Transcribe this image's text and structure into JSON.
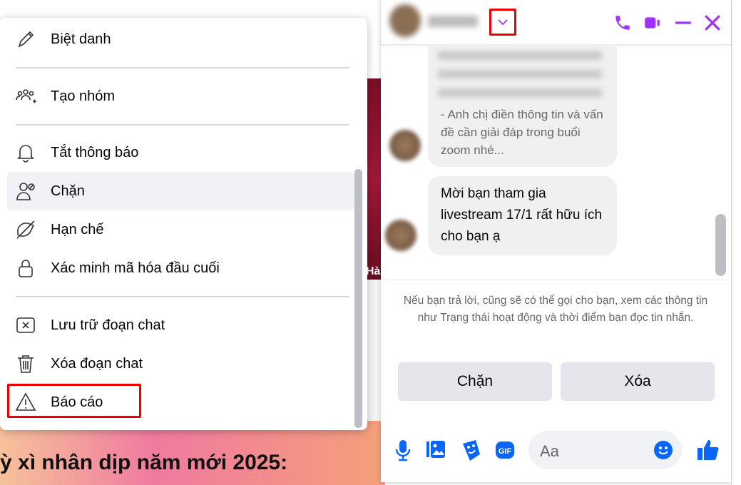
{
  "background": {
    "image_caption": "Hà",
    "banner_text": "ỳ xì nhân dịp năm mới 2025:"
  },
  "menu": {
    "items": [
      {
        "label": "Biệt danh",
        "icon": "pencil-icon"
      },
      {
        "label": "Tạo nhóm",
        "icon": "group-add-icon"
      },
      {
        "label": "Tắt thông báo",
        "icon": "bell-icon"
      },
      {
        "label": "Chặn",
        "icon": "block-user-icon",
        "highlighted": true
      },
      {
        "label": "Hạn chế",
        "icon": "restrict-icon"
      },
      {
        "label": "Xác minh mã hóa đầu cuối",
        "icon": "lock-icon"
      },
      {
        "label": "Lưu trữ đoạn chat",
        "icon": "archive-icon"
      },
      {
        "label": "Xóa đoạn chat",
        "icon": "trash-icon"
      },
      {
        "label": "Báo cáo",
        "icon": "warning-icon",
        "highlighted_box": true
      }
    ]
  },
  "chat": {
    "accent": "#a033ff",
    "messages": [
      {
        "text": "- Anh chị điền thông tin và vấn đề cần giải đáp trong buổi zoom nhé..."
      },
      {
        "text": "Mời bạn tham gia livestream 17/1 rất hữu ích cho bạn ạ"
      }
    ],
    "notice": "Nếu bạn trả lời,            cũng sẽ có thể gọi cho bạn, xem các thông tin như Trạng thái hoạt động và thời điểm bạn đọc tin nhắn.",
    "block_label": "Chặn",
    "delete_label": "Xóa",
    "input_placeholder": "Aa"
  }
}
